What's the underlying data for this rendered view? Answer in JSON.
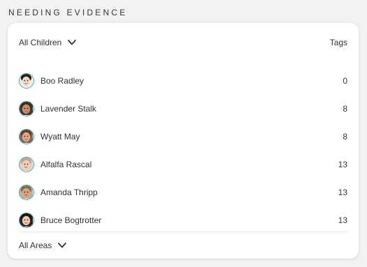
{
  "section": {
    "title": "NEEDING EVIDENCE"
  },
  "header": {
    "filter_label": "All Children",
    "tags_label": "Tags",
    "filter_icon": "chevron-down-icon"
  },
  "children": [
    {
      "name": "Boo Radley",
      "tags": "0",
      "avatar_skin": "#f0d7c4",
      "avatar_hair": "#2b1c14",
      "avatar_bg": "#e8eef4"
    },
    {
      "name": "Lavender Stalk",
      "tags": "8",
      "avatar_skin": "#c98e6a",
      "avatar_hair": "#4a2a18",
      "avatar_bg": "#3a3a3a"
    },
    {
      "name": "Wyatt May",
      "tags": "8",
      "avatar_skin": "#e2a88c",
      "avatar_hair": "#6b3a22",
      "avatar_bg": "#7a6a60"
    },
    {
      "name": "Alfalfa Rascal",
      "tags": "13",
      "avatar_skin": "#f3cdb9",
      "avatar_hair": "#c9a184",
      "avatar_bg": "#d8d4d0"
    },
    {
      "name": "Amanda Thripp",
      "tags": "13",
      "avatar_skin": "#d8a47e",
      "avatar_hair": "#8b6a4a",
      "avatar_bg": "#b8b0a8"
    },
    {
      "name": "Bruce Bogtrotter",
      "tags": "13",
      "avatar_skin": "#efc8b0",
      "avatar_hair": "#1e140e",
      "avatar_bg": "#2a2320"
    }
  ],
  "footer": {
    "areas_label": "All Areas",
    "areas_icon": "chevron-down-icon"
  },
  "colors": {
    "avatar_ring": "#3fa6a0",
    "text": "#333333"
  }
}
